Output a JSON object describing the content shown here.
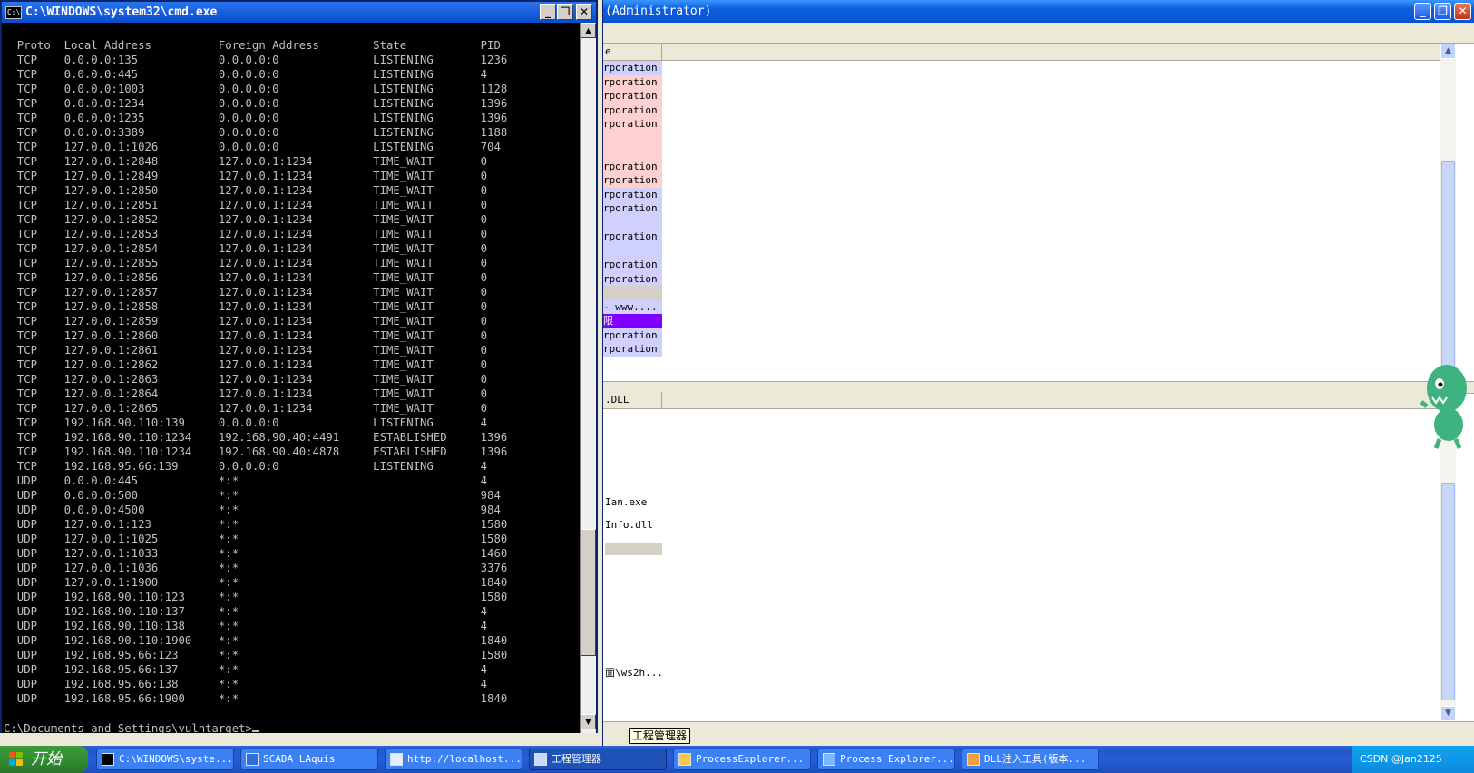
{
  "cmd": {
    "title": "C:\\WINDOWS\\system32\\cmd.exe",
    "header": "Proto  Local Address          Foreign Address        State           PID",
    "rows": [
      {
        "proto": "TCP",
        "local": "0.0.0.0:135",
        "foreign": "0.0.0.0:0",
        "state": "LISTENING",
        "pid": "1236"
      },
      {
        "proto": "TCP",
        "local": "0.0.0.0:445",
        "foreign": "0.0.0.0:0",
        "state": "LISTENING",
        "pid": "4"
      },
      {
        "proto": "TCP",
        "local": "0.0.0.0:1003",
        "foreign": "0.0.0.0:0",
        "state": "LISTENING",
        "pid": "1128"
      },
      {
        "proto": "TCP",
        "local": "0.0.0.0:1234",
        "foreign": "0.0.0.0:0",
        "state": "LISTENING",
        "pid": "1396"
      },
      {
        "proto": "TCP",
        "local": "0.0.0.0:1235",
        "foreign": "0.0.0.0:0",
        "state": "LISTENING",
        "pid": "1396"
      },
      {
        "proto": "TCP",
        "local": "0.0.0.0:3389",
        "foreign": "0.0.0.0:0",
        "state": "LISTENING",
        "pid": "1188"
      },
      {
        "proto": "TCP",
        "local": "127.0.0.1:1026",
        "foreign": "0.0.0.0:0",
        "state": "LISTENING",
        "pid": "704"
      },
      {
        "proto": "TCP",
        "local": "127.0.0.1:2848",
        "foreign": "127.0.0.1:1234",
        "state": "TIME_WAIT",
        "pid": "0"
      },
      {
        "proto": "TCP",
        "local": "127.0.0.1:2849",
        "foreign": "127.0.0.1:1234",
        "state": "TIME_WAIT",
        "pid": "0"
      },
      {
        "proto": "TCP",
        "local": "127.0.0.1:2850",
        "foreign": "127.0.0.1:1234",
        "state": "TIME_WAIT",
        "pid": "0"
      },
      {
        "proto": "TCP",
        "local": "127.0.0.1:2851",
        "foreign": "127.0.0.1:1234",
        "state": "TIME_WAIT",
        "pid": "0"
      },
      {
        "proto": "TCP",
        "local": "127.0.0.1:2852",
        "foreign": "127.0.0.1:1234",
        "state": "TIME_WAIT",
        "pid": "0"
      },
      {
        "proto": "TCP",
        "local": "127.0.0.1:2853",
        "foreign": "127.0.0.1:1234",
        "state": "TIME_WAIT",
        "pid": "0"
      },
      {
        "proto": "TCP",
        "local": "127.0.0.1:2854",
        "foreign": "127.0.0.1:1234",
        "state": "TIME_WAIT",
        "pid": "0"
      },
      {
        "proto": "TCP",
        "local": "127.0.0.1:2855",
        "foreign": "127.0.0.1:1234",
        "state": "TIME_WAIT",
        "pid": "0"
      },
      {
        "proto": "TCP",
        "local": "127.0.0.1:2856",
        "foreign": "127.0.0.1:1234",
        "state": "TIME_WAIT",
        "pid": "0"
      },
      {
        "proto": "TCP",
        "local": "127.0.0.1:2857",
        "foreign": "127.0.0.1:1234",
        "state": "TIME_WAIT",
        "pid": "0"
      },
      {
        "proto": "TCP",
        "local": "127.0.0.1:2858",
        "foreign": "127.0.0.1:1234",
        "state": "TIME_WAIT",
        "pid": "0"
      },
      {
        "proto": "TCP",
        "local": "127.0.0.1:2859",
        "foreign": "127.0.0.1:1234",
        "state": "TIME_WAIT",
        "pid": "0"
      },
      {
        "proto": "TCP",
        "local": "127.0.0.1:2860",
        "foreign": "127.0.0.1:1234",
        "state": "TIME_WAIT",
        "pid": "0"
      },
      {
        "proto": "TCP",
        "local": "127.0.0.1:2861",
        "foreign": "127.0.0.1:1234",
        "state": "TIME_WAIT",
        "pid": "0"
      },
      {
        "proto": "TCP",
        "local": "127.0.0.1:2862",
        "foreign": "127.0.0.1:1234",
        "state": "TIME_WAIT",
        "pid": "0"
      },
      {
        "proto": "TCP",
        "local": "127.0.0.1:2863",
        "foreign": "127.0.0.1:1234",
        "state": "TIME_WAIT",
        "pid": "0"
      },
      {
        "proto": "TCP",
        "local": "127.0.0.1:2864",
        "foreign": "127.0.0.1:1234",
        "state": "TIME_WAIT",
        "pid": "0"
      },
      {
        "proto": "TCP",
        "local": "127.0.0.1:2865",
        "foreign": "127.0.0.1:1234",
        "state": "TIME_WAIT",
        "pid": "0"
      },
      {
        "proto": "TCP",
        "local": "192.168.90.110:139",
        "foreign": "0.0.0.0:0",
        "state": "LISTENING",
        "pid": "4"
      },
      {
        "proto": "TCP",
        "local": "192.168.90.110:1234",
        "foreign": "192.168.90.40:4491",
        "state": "ESTABLISHED",
        "pid": "1396"
      },
      {
        "proto": "TCP",
        "local": "192.168.90.110:1234",
        "foreign": "192.168.90.40:4878",
        "state": "ESTABLISHED",
        "pid": "1396"
      },
      {
        "proto": "TCP",
        "local": "192.168.95.66:139",
        "foreign": "0.0.0.0:0",
        "state": "LISTENING",
        "pid": "4"
      },
      {
        "proto": "UDP",
        "local": "0.0.0.0:445",
        "foreign": "*:*",
        "state": "",
        "pid": "4"
      },
      {
        "proto": "UDP",
        "local": "0.0.0.0:500",
        "foreign": "*:*",
        "state": "",
        "pid": "984"
      },
      {
        "proto": "UDP",
        "local": "0.0.0.0:4500",
        "foreign": "*:*",
        "state": "",
        "pid": "984"
      },
      {
        "proto": "UDP",
        "local": "127.0.0.1:123",
        "foreign": "*:*",
        "state": "",
        "pid": "1580"
      },
      {
        "proto": "UDP",
        "local": "127.0.0.1:1025",
        "foreign": "*:*",
        "state": "",
        "pid": "1580"
      },
      {
        "proto": "UDP",
        "local": "127.0.0.1:1033",
        "foreign": "*:*",
        "state": "",
        "pid": "1460"
      },
      {
        "proto": "UDP",
        "local": "127.0.0.1:1036",
        "foreign": "*:*",
        "state": "",
        "pid": "3376"
      },
      {
        "proto": "UDP",
        "local": "127.0.0.1:1900",
        "foreign": "*:*",
        "state": "",
        "pid": "1840"
      },
      {
        "proto": "UDP",
        "local": "192.168.90.110:123",
        "foreign": "*:*",
        "state": "",
        "pid": "1580"
      },
      {
        "proto": "UDP",
        "local": "192.168.90.110:137",
        "foreign": "*:*",
        "state": "",
        "pid": "4"
      },
      {
        "proto": "UDP",
        "local": "192.168.90.110:138",
        "foreign": "*:*",
        "state": "",
        "pid": "4"
      },
      {
        "proto": "UDP",
        "local": "192.168.90.110:1900",
        "foreign": "*:*",
        "state": "",
        "pid": "1840"
      },
      {
        "proto": "UDP",
        "local": "192.168.95.66:123",
        "foreign": "*:*",
        "state": "",
        "pid": "1580"
      },
      {
        "proto": "UDP",
        "local": "192.168.95.66:137",
        "foreign": "*:*",
        "state": "",
        "pid": "4"
      },
      {
        "proto": "UDP",
        "local": "192.168.95.66:138",
        "foreign": "*:*",
        "state": "",
        "pid": "4"
      },
      {
        "proto": "UDP",
        "local": "192.168.95.66:1900",
        "foreign": "*:*",
        "state": "",
        "pid": "1840"
      }
    ],
    "prompt": "C:\\Documents and Settings\\vulntarget>"
  },
  "process_explorer": {
    "title_fragment": "(Administrator)",
    "upper_header": "e",
    "upper_rows": [
      {
        "text": "rporation",
        "bg": "#d0d0ff"
      },
      {
        "text": "rporation",
        "bg": "#ffd0d0"
      },
      {
        "text": "rporation",
        "bg": "#ffd0d0"
      },
      {
        "text": "rporation",
        "bg": "#ffd0d0"
      },
      {
        "text": "rporation",
        "bg": "#ffd0d0"
      },
      {
        "text": "",
        "bg": "#ffd0d0"
      },
      {
        "text": "",
        "bg": "#ffd0d0"
      },
      {
        "text": "rporation",
        "bg": "#ffd0d0"
      },
      {
        "text": "rporation",
        "bg": "#ffd0d0"
      },
      {
        "text": "rporation",
        "bg": "#d0d0ff"
      },
      {
        "text": "rporation",
        "bg": "#d0d0ff"
      },
      {
        "text": "",
        "bg": "#d0d0ff"
      },
      {
        "text": "rporation",
        "bg": "#d0d0ff"
      },
      {
        "text": "",
        "bg": "#d0d0ff"
      },
      {
        "text": "rporation",
        "bg": "#d0d0ff"
      },
      {
        "text": "rporation",
        "bg": "#d0d0ff"
      },
      {
        "text": "",
        "bg": "#d4d0c8"
      },
      {
        "text": " - www....",
        "bg": "#d0d0ff"
      },
      {
        "text": "限",
        "bg": "#8000ff"
      },
      {
        "text": "rporation",
        "bg": "#d0d0ff"
      },
      {
        "text": "rporation",
        "bg": "#d0d0ff"
      }
    ],
    "lower_rows": [
      {
        "text": ".DLL",
        "offset": 0
      },
      {
        "text": "Ian.exe",
        "offset": 8
      },
      {
        "text": "Info.dll",
        "offset": 10
      },
      {
        "text": "",
        "offset": 12
      },
      {
        "text": "面\\ws2h...",
        "offset": 22
      }
    ],
    "tooltip": "工程管理器"
  },
  "taskbar": {
    "start_label": "开始",
    "items": [
      {
        "label": "C:\\WINDOWS\\syste...",
        "icon": "cmd-icon",
        "active": false
      },
      {
        "label": "SCADA LAquis",
        "icon": "scada-icon",
        "active": false
      },
      {
        "label": "http://localhost...",
        "icon": "browser-icon",
        "active": false
      },
      {
        "label": "工程管理器",
        "icon": "project-manager-icon",
        "active": true
      },
      {
        "label": "ProcessExplorer...",
        "icon": "folder-icon",
        "active": false
      },
      {
        "label": "Process Explorer...",
        "icon": "process-explorer-icon",
        "active": false
      },
      {
        "label": "DLL注入工具(版本...",
        "icon": "dll-injector-icon",
        "active": false
      }
    ],
    "tray_text": "CSDN @Jan2125"
  }
}
